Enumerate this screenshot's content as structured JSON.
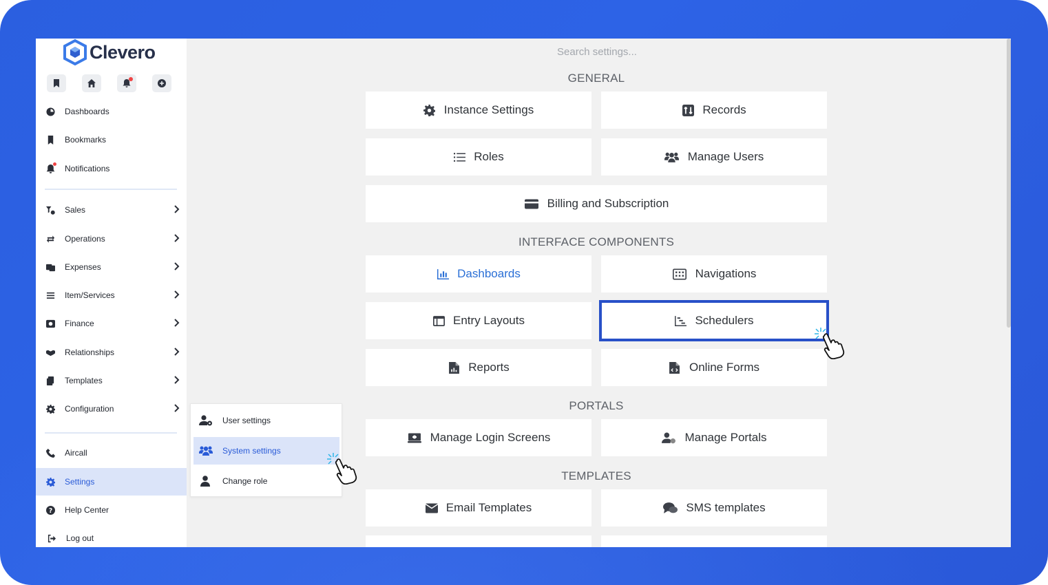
{
  "app": {
    "brand": "Clevero",
    "accent_color": "#2a5bd7",
    "frame_color": "#2d63e6"
  },
  "sidebar": {
    "quick_actions": [
      {
        "icon": "bookmark-icon"
      },
      {
        "icon": "home-icon"
      },
      {
        "icon": "bell-icon",
        "has_dot": true
      },
      {
        "icon": "plus-circle-icon"
      }
    ],
    "top_items": [
      {
        "label": "Dashboards",
        "icon": "dashboard-icon"
      },
      {
        "label": "Bookmarks",
        "icon": "bookmark-icon"
      },
      {
        "label": "Notifications",
        "icon": "bell-icon"
      }
    ],
    "module_items": [
      {
        "label": "Sales",
        "icon": "sales-icon"
      },
      {
        "label": "Operations",
        "icon": "operations-icon"
      },
      {
        "label": "Expenses",
        "icon": "expenses-icon"
      },
      {
        "label": "Item/Services",
        "icon": "list-icon"
      },
      {
        "label": "Finance",
        "icon": "finance-icon"
      },
      {
        "label": "Relationships",
        "icon": "handshake-icon"
      },
      {
        "label": "Templates",
        "icon": "templates-icon"
      },
      {
        "label": "Configuration",
        "icon": "gear-icon"
      }
    ],
    "bottom_items": [
      {
        "label": "Aircall",
        "icon": "phone-icon"
      },
      {
        "label": "Settings",
        "icon": "gear-icon",
        "active": true
      },
      {
        "label": "Help Center",
        "icon": "help-icon"
      },
      {
        "label": "Log out",
        "icon": "logout-icon"
      }
    ]
  },
  "settings_menu": {
    "items": [
      {
        "label": "User settings",
        "icon": "user-gear-icon"
      },
      {
        "label": "System settings",
        "icon": "users-icon",
        "active": true
      },
      {
        "label": "Change role",
        "icon": "user-icon"
      }
    ]
  },
  "main": {
    "search_placeholder": "Search settings...",
    "sections": {
      "general": "GENERAL",
      "interface": "INTERFACE COMPONENTS",
      "portals": "PORTALS",
      "templates": "TEMPLATES"
    },
    "cards": {
      "instance_settings": "Instance Settings",
      "records": "Records",
      "roles": "Roles",
      "manage_users": "Manage Users",
      "billing": "Billing and Subscription",
      "dashboards": "Dashboards",
      "navigations": "Navigations",
      "entry_layouts": "Entry Layouts",
      "schedulers": "Schedulers",
      "reports": "Reports",
      "online_forms": "Online Forms",
      "manage_login_screens": "Manage Login Screens",
      "manage_portals": "Manage Portals",
      "email_templates": "Email Templates",
      "sms_templates": "SMS templates"
    }
  }
}
